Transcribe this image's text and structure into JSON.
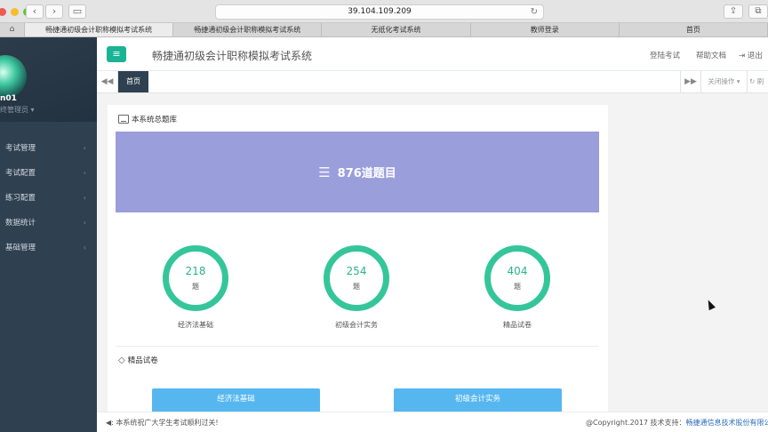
{
  "browser": {
    "url": "39.104.109.209",
    "tabs": [
      {
        "label": "畅捷通初级会计职称模拟考试系统",
        "active": true
      },
      {
        "label": "畅捷通初级会计职称模拟考试系统",
        "active": false
      },
      {
        "label": "无纸化考试系统",
        "active": false
      },
      {
        "label": "教师登录",
        "active": false
      },
      {
        "label": "首页",
        "active": false
      }
    ]
  },
  "sidebar": {
    "user_name": "n01",
    "user_role": "终管理员 ▾",
    "items": [
      {
        "label": "考试管理"
      },
      {
        "label": "考试配置"
      },
      {
        "label": "练习配置"
      },
      {
        "label": "数据统计"
      },
      {
        "label": "基础管理"
      }
    ]
  },
  "header": {
    "title": "畅捷通初级会计职称模拟考试系统",
    "links": {
      "login_exam": "登陆考试",
      "help_docs": "帮助文档",
      "logout": "退出"
    }
  },
  "content_tabs": {
    "home": "首页",
    "close_ops": "关闭操作",
    "refresh": "刷"
  },
  "panel": {
    "heading": "本系统总题库",
    "total": "876道题目",
    "stats": [
      {
        "value": "218",
        "unit": "题",
        "label": "经济法基础"
      },
      {
        "value": "254",
        "unit": "题",
        "label": "初级会计实务"
      },
      {
        "value": "404",
        "unit": "题",
        "label": "精品试卷"
      }
    ],
    "section2_heading": "精品试卷",
    "paper_buttons": [
      "经济法基础",
      "初级会计实务"
    ]
  },
  "footer": {
    "notice": "本系统祝广大学生考试顺利过关!",
    "copyright": "@Copyright.2017 技术支持：",
    "company": "畅捷通信息技术股份有限公司"
  },
  "colors": {
    "accent": "#1ab394",
    "sidebar_bg": "#2f4050",
    "banner": "#9a9edb",
    "ring": "#34c69a",
    "button": "#56b7f0"
  }
}
